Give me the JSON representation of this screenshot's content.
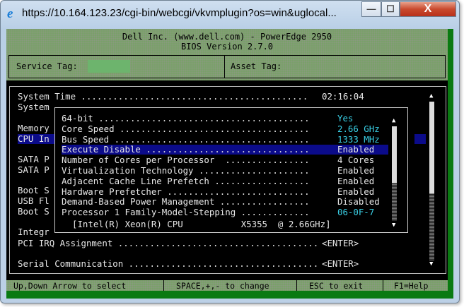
{
  "window": {
    "title": "https://10.164.123.23/cgi-bin/webcgi/vkvmplugin?os=win&uglocal...",
    "minimize": "—",
    "maximize": "☐",
    "close": "X"
  },
  "header": {
    "line1": "Dell Inc. (www.dell.com) - PowerEdge 2950",
    "line2": "BIOS Version 2.7.0",
    "service_tag_label": "Service Tag:",
    "asset_tag_label": "Asset Tag:"
  },
  "main": {
    "system_time": {
      "label": "System Time ...........................................",
      "value": "02:16:04"
    },
    "left_items": [
      "System",
      "Memory",
      "CPU In",
      "SATA P",
      "SATA P",
      "Boot S",
      "USB Fl",
      "Boot S",
      "Integr"
    ],
    "pci": {
      "label": "PCI IRQ Assignment ......................................",
      "value": "<ENTER>"
    },
    "serial": {
      "label": "Serial Communication ....................................",
      "value": "<ENTER>"
    }
  },
  "popup": {
    "rows": [
      {
        "label": "64-bit ........................................",
        "value": "Yes",
        "cyan": true
      },
      {
        "label": "Core Speed ....................................",
        "value": "2.66 GHz",
        "cyan": true
      },
      {
        "label": "Bus Speed .....................................",
        "value": "1333 MHz",
        "cyan": true
      },
      {
        "label": "Execute Disable ...............................",
        "value": "Enabled",
        "cyan": false
      },
      {
        "label": "Number of Cores per Processor  ................",
        "value": "4 Cores",
        "cyan": false
      },
      {
        "label": "Virtualization Technology .....................",
        "value": "Enabled",
        "cyan": false
      },
      {
        "label": "Adjacent Cache Line Prefetch ..................",
        "value": "Enabled",
        "cyan": false
      },
      {
        "label": "Hardware Prefetcher ...........................",
        "value": "Enabled",
        "cyan": false
      },
      {
        "label": "Demand-Based Power Management .................",
        "value": "Disabled",
        "cyan": false
      },
      {
        "label": "Processor 1 Family-Model-Stepping .............",
        "value": "06-0F-7",
        "cyan": true
      }
    ],
    "cpu_name": "[Intel(R) Xeon(R) CPU           X5355  @ 2.66GHz]"
  },
  "footer": [
    "Up,Down Arrow to select",
    "SPACE,+,- to change",
    "ESC to exit",
    "F1=Help"
  ]
}
